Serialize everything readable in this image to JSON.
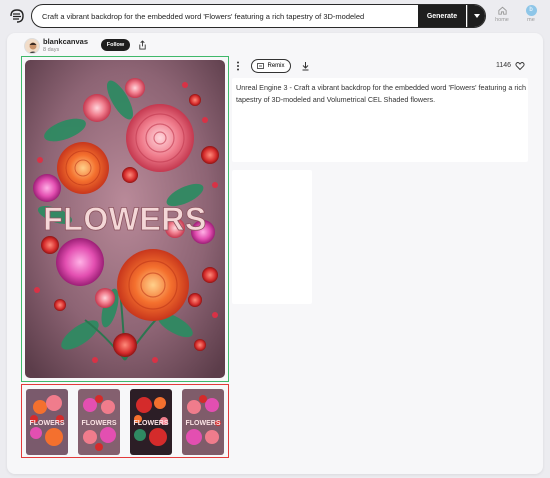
{
  "search": {
    "value": "Craft a vibrant backdrop for the embedded word 'Flowers' featuring a rich tapestry of 3D-modeled",
    "generate_label": "Generate"
  },
  "nav": {
    "home_label": "home",
    "me_label": "me",
    "me_initial": "b"
  },
  "post": {
    "author": "blankcanvas",
    "age": "8 days",
    "follow_label": "Follow",
    "remix_label": "Remix",
    "likes": "1146",
    "image_text": "FLOWERS",
    "description": "Unreal Engine 3 - Craft a vibrant backdrop for the embedded word 'Flowers' featuring a rich tapestry of 3D-modeled and Volumetrical CEL Shaded flowers.",
    "thumbnails": [
      {
        "text": "FLOWERS",
        "bg": "#7a5a6c"
      },
      {
        "text": "FLOWERS",
        "bg": "#84606f"
      },
      {
        "text": "FLOWERS",
        "bg": "#2c1e26"
      },
      {
        "text": "FLOWERS",
        "bg": "#7f5c6a"
      }
    ]
  },
  "colors": {
    "selected_border": "#3fb86a",
    "variants_border": "#e23a3a",
    "dark_button": "#1e1e1e"
  }
}
